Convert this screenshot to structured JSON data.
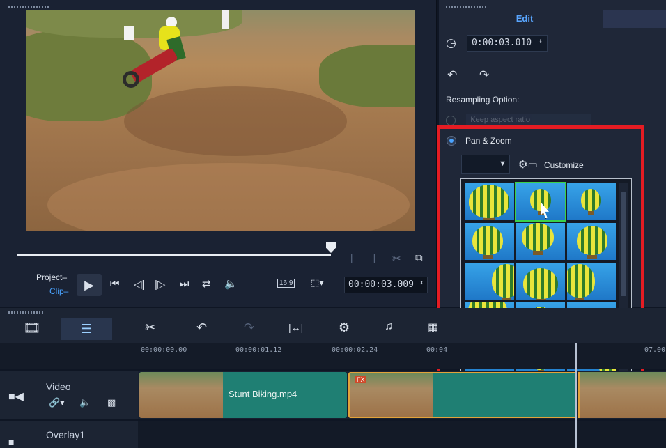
{
  "preview": {
    "project_label": "Project–",
    "clip_label": "Clip–",
    "aspect": "16:9",
    "timecode": "00:00:03.009"
  },
  "options": {
    "edit_tab": "Edit",
    "duration": "0:00:03.010",
    "resampling_label": "Resampling Option:",
    "keep_aspect_label": "Keep aspect ratio",
    "panzoom_label": "Pan & Zoom",
    "customize_label": "Customize"
  },
  "timeline": {
    "ruler_ticks": [
      "00:00:00.00",
      "00:00:01.12",
      "00:00:02.24",
      "00:04",
      "07.00"
    ],
    "video_track_label": "Video",
    "overlay_track_label": "Overlay1",
    "clip_name": "Stunt Biking.mp4",
    "fx_badge": "FX"
  },
  "colors": {
    "accent": "#4aa3ff",
    "highlight": "#e51c23",
    "clip": "#1f7f73"
  }
}
